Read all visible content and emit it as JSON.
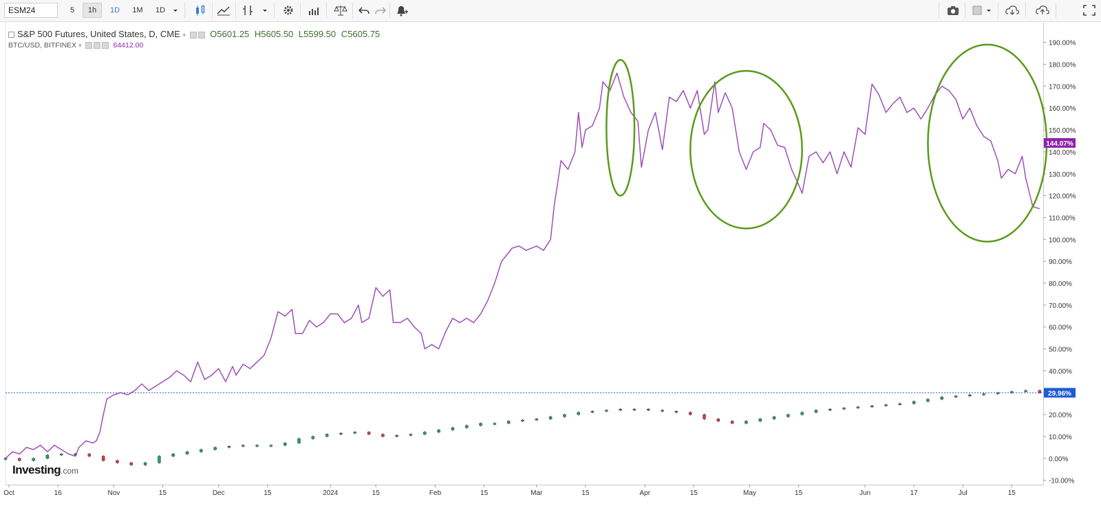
{
  "toolbar": {
    "symbol": "ESM24",
    "intervals": [
      "5",
      "1h",
      "1D",
      "1M",
      "1D"
    ],
    "active_interval": "1h"
  },
  "legend": {
    "main_title": "S&P 500 Futures, United States, D, CME",
    "open": "O5601.25",
    "high": "H5605.50",
    "low": "L5599.50",
    "close": "C5605.75",
    "btc_title": "BTC/USD, BITFINEX",
    "btc_value": "64412.00"
  },
  "logo": {
    "name": "Investing",
    "suffix": ".com"
  },
  "colors": {
    "btc_line": "#9c4fb8",
    "annotation": "#5a9a1a",
    "up_candle": "#26a65b",
    "down_candle": "#e53935",
    "dotted_line": "#1e5bd6"
  },
  "chart_data": {
    "type": "line",
    "xlim": [
      "2023-10-01",
      "2024-07-24"
    ],
    "ylim": [
      -12,
      199
    ],
    "y_ticks": [
      "190.00%",
      "180.00%",
      "170.00%",
      "160.00%",
      "150.00%",
      "140.00%",
      "130.00%",
      "120.00%",
      "110.00%",
      "100.00%",
      "90.00%",
      "80.00%",
      "70.00%",
      "60.00%",
      "50.00%",
      "40.00%",
      "30.00%",
      "20.00%",
      "10.00%",
      "0.00%",
      "-10.00%"
    ],
    "x_ticks": [
      {
        "label": "Oct",
        "date": "2023-10-02"
      },
      {
        "label": "16",
        "date": "2023-10-16"
      },
      {
        "label": "Nov",
        "date": "2023-11-01"
      },
      {
        "label": "15",
        "date": "2023-11-15"
      },
      {
        "label": "Dec",
        "date": "2023-12-01"
      },
      {
        "label": "15",
        "date": "2023-12-15"
      },
      {
        "label": "2024",
        "date": "2024-01-02"
      },
      {
        "label": "15",
        "date": "2024-01-15"
      },
      {
        "label": "Feb",
        "date": "2024-02-01"
      },
      {
        "label": "15",
        "date": "2024-02-15"
      },
      {
        "label": "Mar",
        "date": "2024-03-01"
      },
      {
        "label": "15",
        "date": "2024-03-15"
      },
      {
        "label": "Apr",
        "date": "2024-04-01"
      },
      {
        "label": "15",
        "date": "2024-04-15"
      },
      {
        "label": "May",
        "date": "2024-05-01"
      },
      {
        "label": "15",
        "date": "2024-05-15"
      },
      {
        "label": "Jun",
        "date": "2024-06-03"
      },
      {
        "label": "17",
        "date": "2024-06-17"
      },
      {
        "label": "Jul",
        "date": "2024-07-01"
      },
      {
        "label": "15",
        "date": "2024-07-15"
      }
    ],
    "last_labels": [
      {
        "series": "BTC/USD, BITFINEX",
        "text": "144.07%",
        "y": 144.07
      },
      {
        "series": "S&P 500 Futures, United States, D, CME",
        "text": "29.96%",
        "y": 29.96
      }
    ],
    "series": [
      {
        "name": "BTC/USD, BITFINEX",
        "style": "line",
        "points": [
          [
            "2023-10-01",
            0
          ],
          [
            "2023-10-03",
            3
          ],
          [
            "2023-10-05",
            2
          ],
          [
            "2023-10-07",
            5
          ],
          [
            "2023-10-09",
            4
          ],
          [
            "2023-10-11",
            6
          ],
          [
            "2023-10-13",
            3
          ],
          [
            "2023-10-15",
            6
          ],
          [
            "2023-10-17",
            4
          ],
          [
            "2023-10-19",
            2
          ],
          [
            "2023-10-21",
            1
          ],
          [
            "2023-10-22",
            5
          ],
          [
            "2023-10-24",
            8
          ],
          [
            "2023-10-26",
            7
          ],
          [
            "2023-10-27",
            8
          ],
          [
            "2023-10-28",
            12
          ],
          [
            "2023-10-29",
            20
          ],
          [
            "2023-10-30",
            27
          ],
          [
            "2023-11-01",
            29
          ],
          [
            "2023-11-03",
            30
          ],
          [
            "2023-11-05",
            29
          ],
          [
            "2023-11-07",
            31
          ],
          [
            "2023-11-09",
            34
          ],
          [
            "2023-11-11",
            31
          ],
          [
            "2023-11-13",
            33
          ],
          [
            "2023-11-15",
            35
          ],
          [
            "2023-11-17",
            37
          ],
          [
            "2023-11-19",
            40
          ],
          [
            "2023-11-21",
            38
          ],
          [
            "2023-11-23",
            35
          ],
          [
            "2023-11-25",
            44
          ],
          [
            "2023-11-27",
            36
          ],
          [
            "2023-11-29",
            38
          ],
          [
            "2023-12-01",
            41
          ],
          [
            "2023-12-03",
            35
          ],
          [
            "2023-12-05",
            42
          ],
          [
            "2023-12-06",
            38
          ],
          [
            "2023-12-08",
            43
          ],
          [
            "2023-12-10",
            41
          ],
          [
            "2023-12-12",
            44
          ],
          [
            "2023-12-14",
            47
          ],
          [
            "2023-12-16",
            55
          ],
          [
            "2023-12-18",
            67
          ],
          [
            "2023-12-20",
            65
          ],
          [
            "2023-12-22",
            68
          ],
          [
            "2023-12-23",
            57
          ],
          [
            "2023-12-25",
            57
          ],
          [
            "2023-12-27",
            63
          ],
          [
            "2023-12-29",
            60
          ],
          [
            "2023-12-31",
            62
          ],
          [
            "2024-01-02",
            66
          ],
          [
            "2024-01-04",
            66
          ],
          [
            "2024-01-06",
            62
          ],
          [
            "2024-01-08",
            64
          ],
          [
            "2024-01-10",
            70
          ],
          [
            "2024-01-11",
            62
          ],
          [
            "2024-01-13",
            64
          ],
          [
            "2024-01-15",
            78
          ],
          [
            "2024-01-17",
            74
          ],
          [
            "2024-01-19",
            77
          ],
          [
            "2024-01-20",
            62
          ],
          [
            "2024-01-22",
            62
          ],
          [
            "2024-01-24",
            64
          ],
          [
            "2024-01-26",
            60
          ],
          [
            "2024-01-28",
            57
          ],
          [
            "2024-01-29",
            50
          ],
          [
            "2024-01-31",
            52
          ],
          [
            "2024-02-02",
            50
          ],
          [
            "2024-02-04",
            58
          ],
          [
            "2024-02-06",
            64
          ],
          [
            "2024-02-08",
            62
          ],
          [
            "2024-02-10",
            64
          ],
          [
            "2024-02-12",
            62
          ],
          [
            "2024-02-14",
            66
          ],
          [
            "2024-02-16",
            72
          ],
          [
            "2024-02-18",
            80
          ],
          [
            "2024-02-20",
            90
          ],
          [
            "2024-02-22",
            94
          ],
          [
            "2024-02-23",
            96
          ],
          [
            "2024-02-25",
            97
          ],
          [
            "2024-02-27",
            95
          ],
          [
            "2024-03-01",
            97
          ],
          [
            "2024-03-03",
            95
          ],
          [
            "2024-03-05",
            100
          ],
          [
            "2024-03-06",
            115
          ],
          [
            "2024-03-08",
            136
          ],
          [
            "2024-03-10",
            132
          ],
          [
            "2024-03-12",
            140
          ],
          [
            "2024-03-13",
            158
          ],
          [
            "2024-03-14",
            142
          ],
          [
            "2024-03-15",
            150
          ],
          [
            "2024-03-17",
            152
          ],
          [
            "2024-03-19",
            160
          ],
          [
            "2024-03-20",
            172
          ],
          [
            "2024-03-22",
            168
          ],
          [
            "2024-03-24",
            176
          ],
          [
            "2024-03-26",
            165
          ],
          [
            "2024-03-28",
            158
          ],
          [
            "2024-03-30",
            154
          ],
          [
            "2024-03-31",
            133
          ],
          [
            "2024-04-02",
            150
          ],
          [
            "2024-04-04",
            158
          ],
          [
            "2024-04-06",
            141
          ],
          [
            "2024-04-08",
            165
          ],
          [
            "2024-04-10",
            163
          ],
          [
            "2024-04-12",
            168
          ],
          [
            "2024-04-14",
            160
          ],
          [
            "2024-04-16",
            168
          ],
          [
            "2024-04-18",
            148
          ],
          [
            "2024-04-19",
            150
          ],
          [
            "2024-04-21",
            172
          ],
          [
            "2024-04-22",
            158
          ],
          [
            "2024-04-24",
            167
          ],
          [
            "2024-04-26",
            160
          ],
          [
            "2024-04-28",
            140
          ],
          [
            "2024-04-30",
            132
          ],
          [
            "2024-05-02",
            140
          ],
          [
            "2024-05-04",
            142
          ],
          [
            "2024-05-05",
            153
          ],
          [
            "2024-05-07",
            150
          ],
          [
            "2024-05-09",
            143
          ],
          [
            "2024-05-11",
            142
          ],
          [
            "2024-05-13",
            132
          ],
          [
            "2024-05-15",
            125
          ],
          [
            "2024-05-16",
            121
          ],
          [
            "2024-05-18",
            138
          ],
          [
            "2024-05-20",
            140
          ],
          [
            "2024-05-22",
            135
          ],
          [
            "2024-05-24",
            140
          ],
          [
            "2024-05-26",
            130
          ],
          [
            "2024-05-28",
            140
          ],
          [
            "2024-05-30",
            133
          ],
          [
            "2024-06-01",
            151
          ],
          [
            "2024-06-03",
            148
          ],
          [
            "2024-06-05",
            171
          ],
          [
            "2024-06-07",
            166
          ],
          [
            "2024-06-09",
            158
          ],
          [
            "2024-06-11",
            162
          ],
          [
            "2024-06-13",
            165
          ],
          [
            "2024-06-15",
            158
          ],
          [
            "2024-06-17",
            160
          ],
          [
            "2024-06-19",
            155
          ],
          [
            "2024-06-21",
            160
          ],
          [
            "2024-06-23",
            166
          ],
          [
            "2024-06-25",
            170
          ],
          [
            "2024-06-27",
            168
          ],
          [
            "2024-06-29",
            164
          ],
          [
            "2024-07-01",
            155
          ],
          [
            "2024-07-03",
            160
          ],
          [
            "2024-07-05",
            152
          ],
          [
            "2024-07-07",
            147
          ],
          [
            "2024-07-09",
            145
          ],
          [
            "2024-07-11",
            136
          ],
          [
            "2024-07-12",
            128
          ],
          [
            "2024-07-14",
            132
          ],
          [
            "2024-07-16",
            130
          ],
          [
            "2024-07-18",
            138
          ],
          [
            "2024-07-19",
            128
          ],
          [
            "2024-07-21",
            115
          ],
          [
            "2024-07-23",
            114
          ]
        ]
      },
      {
        "name": "S&P 500 Futures, United States, D, CME",
        "style": "candlestick",
        "points": [
          [
            "2023-10-01",
            0
          ],
          [
            "2023-10-05",
            -1
          ],
          [
            "2023-10-09",
            0
          ],
          [
            "2023-10-13",
            1.5
          ],
          [
            "2023-10-17",
            2
          ],
          [
            "2023-10-21",
            2
          ],
          [
            "2023-10-25",
            1
          ],
          [
            "2023-10-29",
            -1
          ],
          [
            "2023-11-02",
            -2
          ],
          [
            "2023-11-06",
            -3
          ],
          [
            "2023-11-10",
            -2
          ],
          [
            "2023-11-14",
            1
          ],
          [
            "2023-11-18",
            2
          ],
          [
            "2023-11-22",
            3
          ],
          [
            "2023-11-26",
            4
          ],
          [
            "2023-11-30",
            5
          ],
          [
            "2023-12-04",
            5.5
          ],
          [
            "2023-12-08",
            6
          ],
          [
            "2023-12-12",
            6
          ],
          [
            "2023-12-16",
            6
          ],
          [
            "2023-12-20",
            7
          ],
          [
            "2023-12-24",
            9
          ],
          [
            "2023-12-28",
            10
          ],
          [
            "2024-01-01",
            11
          ],
          [
            "2024-01-05",
            11.5
          ],
          [
            "2024-01-09",
            12
          ],
          [
            "2024-01-13",
            11
          ],
          [
            "2024-01-17",
            10
          ],
          [
            "2024-01-21",
            10.5
          ],
          [
            "2024-01-25",
            11
          ],
          [
            "2024-01-29",
            12
          ],
          [
            "2024-02-02",
            13
          ],
          [
            "2024-02-06",
            14
          ],
          [
            "2024-02-10",
            15
          ],
          [
            "2024-02-14",
            16
          ],
          [
            "2024-02-18",
            16
          ],
          [
            "2024-02-22",
            17
          ],
          [
            "2024-02-26",
            17.5
          ],
          [
            "2024-03-01",
            18
          ],
          [
            "2024-03-05",
            19
          ],
          [
            "2024-03-09",
            20
          ],
          [
            "2024-03-13",
            21
          ],
          [
            "2024-03-17",
            21.5
          ],
          [
            "2024-03-21",
            22
          ],
          [
            "2024-03-25",
            22.5
          ],
          [
            "2024-03-29",
            22.5
          ],
          [
            "2024-04-02",
            22
          ],
          [
            "2024-04-06",
            21.5
          ],
          [
            "2024-04-10",
            21
          ],
          [
            "2024-04-14",
            20
          ],
          [
            "2024-04-18",
            18
          ],
          [
            "2024-04-22",
            17
          ],
          [
            "2024-04-26",
            16
          ],
          [
            "2024-04-30",
            17
          ],
          [
            "2024-05-04",
            18
          ],
          [
            "2024-05-08",
            19
          ],
          [
            "2024-05-12",
            20
          ],
          [
            "2024-05-16",
            21
          ],
          [
            "2024-05-20",
            22
          ],
          [
            "2024-05-24",
            22.5
          ],
          [
            "2024-05-28",
            23
          ],
          [
            "2024-06-01",
            23.5
          ],
          [
            "2024-06-05",
            24
          ],
          [
            "2024-06-09",
            24.5
          ],
          [
            "2024-06-13",
            25
          ],
          [
            "2024-06-17",
            26
          ],
          [
            "2024-06-21",
            27
          ],
          [
            "2024-06-25",
            28
          ],
          [
            "2024-06-29",
            28.5
          ],
          [
            "2024-07-03",
            29
          ],
          [
            "2024-07-07",
            29.5
          ],
          [
            "2024-07-11",
            30
          ],
          [
            "2024-07-15",
            30.5
          ],
          [
            "2024-07-19",
            31
          ],
          [
            "2024-07-23",
            29.96
          ]
        ]
      }
    ],
    "annotations": [
      {
        "type": "ellipse",
        "center": [
          "2024-03-25",
          151
        ],
        "radius_days": 4,
        "radius_value": 31
      },
      {
        "type": "ellipse",
        "center": [
          "2024-04-30",
          141
        ],
        "radius_days": 16,
        "radius_value": 36
      },
      {
        "type": "ellipse",
        "center": [
          "2024-07-08",
          144
        ],
        "radius_days": 17,
        "radius_value": 45
      }
    ]
  }
}
